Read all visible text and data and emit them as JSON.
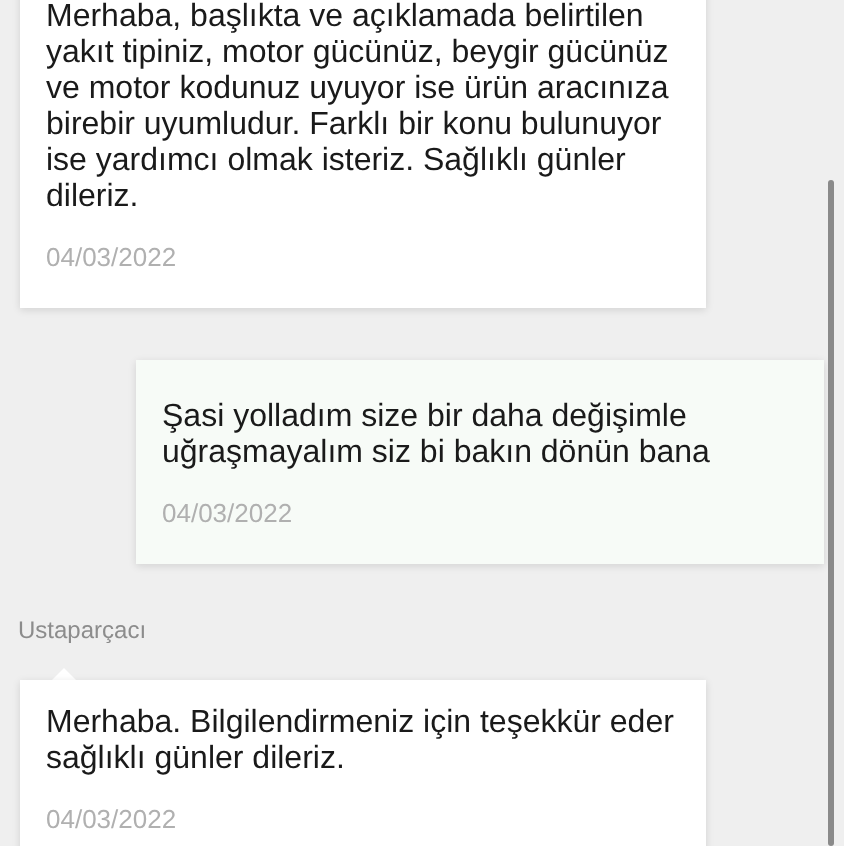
{
  "messages": [
    {
      "kind": "incoming",
      "text": "Merhaba, başlıkta ve açıklamada belirtilen yakıt tipiniz, motor gücünüz, beygir gücünüz ve motor kodunuz uyuyor ise ürün aracınıza birebir uyumludur. Farklı bir konu bulunuyor ise yardımcı olmak isteriz. Sağlıklı günler dileriz.",
      "date": "04/03/2022"
    },
    {
      "kind": "outgoing",
      "text": "Şasi yolladım size bir daha değişimle uğraşmayalım siz bi bakın dönün bana",
      "date": "04/03/2022"
    },
    {
      "kind": "incoming",
      "sender": "Ustaparçacı",
      "text": "Merhaba. Bilgilendirmeniz için teşekkür eder sağlıklı günler dileriz.",
      "date": "04/03/2022"
    }
  ]
}
